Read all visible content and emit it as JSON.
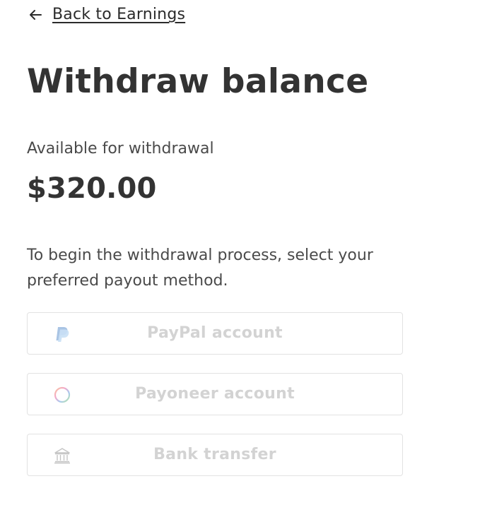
{
  "back_link": {
    "label": "Back to Earnings",
    "icon": "arrow-left-icon"
  },
  "page_title": "Withdraw balance",
  "balance": {
    "label": "Available for withdrawal",
    "amount": "$320.00"
  },
  "instructions": "To begin the withdrawal process, select your preferred payout method.",
  "payout_methods": [
    {
      "label": "PayPal account",
      "icon": "paypal-icon",
      "enabled": false
    },
    {
      "label": "Payoneer account",
      "icon": "payoneer-icon",
      "enabled": false
    },
    {
      "label": "Bank transfer",
      "icon": "bank-icon",
      "enabled": false
    }
  ],
  "colors": {
    "text": "#2b2b2b",
    "disabled_text": "#d3d3d3",
    "border": "#e2e2e2",
    "paypal_dark": "#a9c4e4",
    "paypal_light": "#c9e0f5"
  }
}
